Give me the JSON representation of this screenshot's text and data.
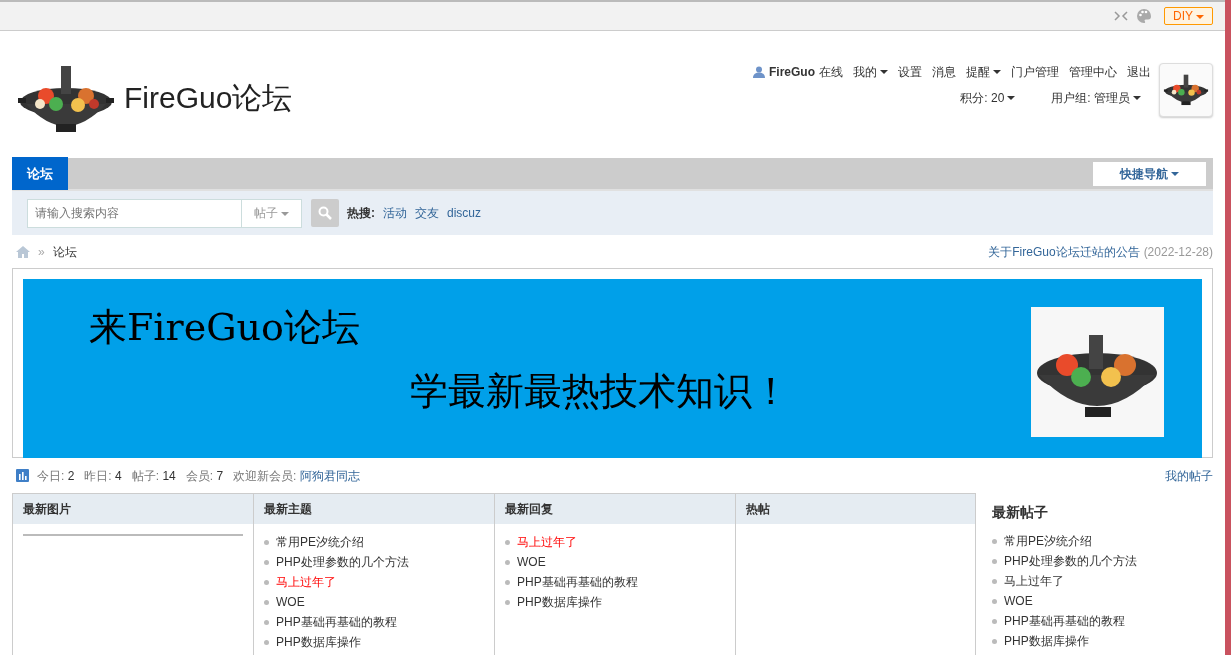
{
  "toolbar": {
    "diy_button": "DIY"
  },
  "header": {
    "title": "FireGuo论坛",
    "user": {
      "name": "FireGuo",
      "status": "在线"
    },
    "links": [
      {
        "label": "我的",
        "dropdown": true
      },
      {
        "label": "设置",
        "dropdown": false
      },
      {
        "label": "消息",
        "dropdown": false
      },
      {
        "label": "提醒",
        "dropdown": true
      },
      {
        "label": "门户管理",
        "dropdown": false
      },
      {
        "label": "管理中心",
        "dropdown": false
      },
      {
        "label": "退出",
        "dropdown": false
      }
    ],
    "credits": "积分: 20",
    "group": "用户组: 管理员"
  },
  "nav": {
    "tabs": [
      {
        "label": "论坛",
        "selected": true
      }
    ],
    "quick_nav": "快捷导航"
  },
  "search": {
    "placeholder": "请输入搜索内容",
    "type": "帖子",
    "hot_label": "热搜:",
    "hot": [
      "活动",
      "交友",
      "discuz"
    ]
  },
  "breadcrumb": {
    "separator": "»",
    "items": [
      "论坛"
    ],
    "notice": "关于FireGuo论坛迁站的公告",
    "notice_date": "(2022-12-28)"
  },
  "banner": {
    "headline": "来FireGuo论坛",
    "slogan": "学最新最热技术知识！"
  },
  "stats": {
    "items": [
      {
        "label": "今日:",
        "value": "2"
      },
      {
        "label": "昨日:",
        "value": "4"
      },
      {
        "label": "帖子:",
        "value": "14"
      },
      {
        "label": "会员:",
        "value": "7"
      }
    ],
    "welcome_label": "欢迎新会员:",
    "new_member": "阿狗君同志",
    "my_posts": "我的帖子"
  },
  "panels": [
    {
      "title": "最新图片"
    },
    {
      "title": "最新主题",
      "items": [
        {
          "text": "常用PE汐统介绍",
          "highlighted": false
        },
        {
          "text": "PHP处理参数的几个方法",
          "highlighted": false
        },
        {
          "text": "马上过年了",
          "highlighted": true
        },
        {
          "text": "WOE",
          "highlighted": false
        },
        {
          "text": "PHP基础再基础的教程",
          "highlighted": false
        },
        {
          "text": "PHP数据库操作",
          "highlighted": false
        }
      ]
    },
    {
      "title": "最新回复",
      "items": [
        {
          "text": "马上过年了",
          "highlighted": true
        },
        {
          "text": "WOE",
          "highlighted": false
        },
        {
          "text": "PHP基础再基础的教程",
          "highlighted": false
        },
        {
          "text": "PHP数据库操作",
          "highlighted": false
        }
      ]
    },
    {
      "title": "热帖"
    }
  ],
  "sidebar": {
    "title": "最新帖子",
    "items": [
      {
        "text": "常用PE汐统介绍",
        "highlighted": false
      },
      {
        "text": "PHP处理参数的几个方法",
        "highlighted": false
      },
      {
        "text": "马上过年了",
        "highlighted": false
      },
      {
        "text": "WOE",
        "highlighted": false
      },
      {
        "text": "PHP基础再基础的教程",
        "highlighted": false
      },
      {
        "text": "PHP数据库操作",
        "highlighted": false
      }
    ]
  }
}
